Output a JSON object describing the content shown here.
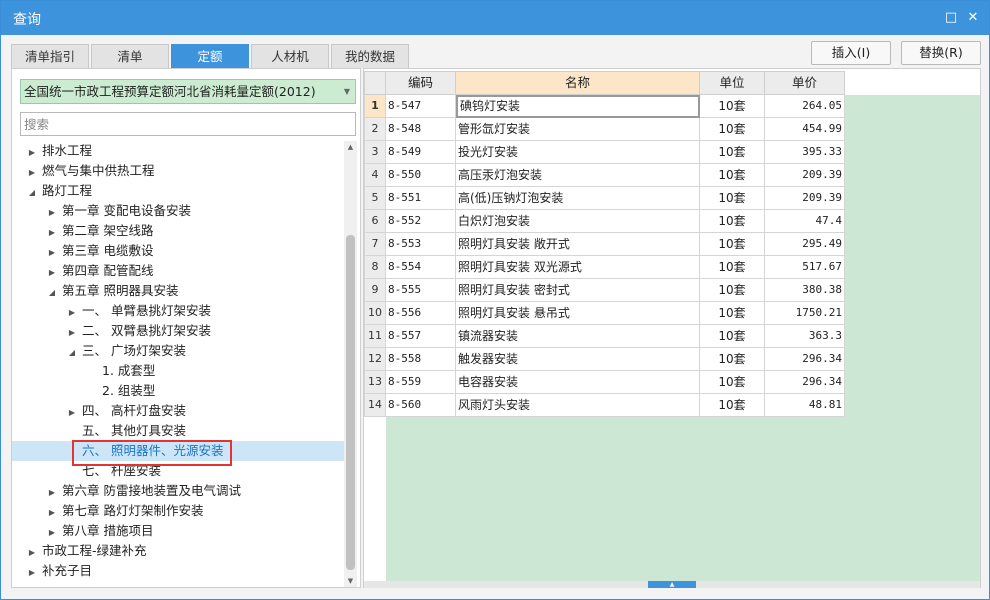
{
  "window": {
    "title": "查询",
    "maximize_glyph": "□",
    "close_glyph": "✕"
  },
  "tabs": [
    {
      "label": "清单指引",
      "active": false
    },
    {
      "label": "清单",
      "active": false
    },
    {
      "label": "定额",
      "active": true
    },
    {
      "label": "人材机",
      "active": false
    },
    {
      "label": "我的数据",
      "active": false
    }
  ],
  "toolbar": {
    "insert_label": "插入(I)",
    "replace_label": "替换(R)"
  },
  "left_panel": {
    "quota_book": "全国统一市政工程预算定额河北省消耗量定额(2012)",
    "search_placeholder": "搜索",
    "tree": [
      {
        "label": "排水工程",
        "level": 0,
        "state": "collapsed"
      },
      {
        "label": "燃气与集中供热工程",
        "level": 0,
        "state": "collapsed"
      },
      {
        "label": "路灯工程",
        "level": 0,
        "state": "expanded"
      },
      {
        "label": "第一章 变配电设备安装",
        "level": 1,
        "state": "collapsed"
      },
      {
        "label": "第二章 架空线路",
        "level": 1,
        "state": "collapsed"
      },
      {
        "label": "第三章 电缆敷设",
        "level": 1,
        "state": "collapsed"
      },
      {
        "label": "第四章 配管配线",
        "level": 1,
        "state": "collapsed"
      },
      {
        "label": "第五章 照明器具安装",
        "level": 1,
        "state": "expanded"
      },
      {
        "label": "一、 单臂悬挑灯架安装",
        "level": 2,
        "state": "collapsed"
      },
      {
        "label": "二、 双臂悬挑灯架安装",
        "level": 2,
        "state": "collapsed"
      },
      {
        "label": "三、 广场灯架安装",
        "level": 2,
        "state": "expanded"
      },
      {
        "label": "1. 成套型",
        "level": 3,
        "state": "leaf"
      },
      {
        "label": "2. 组装型",
        "level": 3,
        "state": "leaf"
      },
      {
        "label": "四、 高杆灯盘安装",
        "level": 2,
        "state": "collapsed"
      },
      {
        "label": "五、 其他灯具安装",
        "level": 2,
        "state": "leaf"
      },
      {
        "label": "六、 照明器件、光源安装",
        "level": 2,
        "state": "leaf",
        "selected": true
      },
      {
        "label": "七、 杆座安装",
        "level": 2,
        "state": "leaf"
      },
      {
        "label": "第六章 防雷接地装置及电气调试",
        "level": 1,
        "state": "collapsed"
      },
      {
        "label": "第七章 路灯灯架制作安装",
        "level": 1,
        "state": "collapsed"
      },
      {
        "label": "第八章 措施项目",
        "level": 1,
        "state": "collapsed"
      },
      {
        "label": "市政工程-绿建补充",
        "level": 0,
        "state": "collapsed"
      },
      {
        "label": "补充子目",
        "level": 0,
        "state": "collapsed"
      }
    ]
  },
  "table": {
    "columns": [
      "编码",
      "名称",
      "单位",
      "单价"
    ],
    "rows": [
      {
        "no": "1",
        "code": "8-547",
        "name": "碘钨灯安装",
        "unit": "10套",
        "price": "264.05"
      },
      {
        "no": "2",
        "code": "8-548",
        "name": "管形氙灯安装",
        "unit": "10套",
        "price": "454.99"
      },
      {
        "no": "3",
        "code": "8-549",
        "name": "投光灯安装",
        "unit": "10套",
        "price": "395.33"
      },
      {
        "no": "4",
        "code": "8-550",
        "name": "高压汞灯泡安装",
        "unit": "10套",
        "price": "209.39"
      },
      {
        "no": "5",
        "code": "8-551",
        "name": "高(低)压钠灯泡安装",
        "unit": "10套",
        "price": "209.39"
      },
      {
        "no": "6",
        "code": "8-552",
        "name": "白炽灯泡安装",
        "unit": "10套",
        "price": "47.4"
      },
      {
        "no": "7",
        "code": "8-553",
        "name": "照明灯具安装 敞开式",
        "unit": "10套",
        "price": "295.49"
      },
      {
        "no": "8",
        "code": "8-554",
        "name": "照明灯具安装 双光源式",
        "unit": "10套",
        "price": "517.67"
      },
      {
        "no": "9",
        "code": "8-555",
        "name": "照明灯具安装 密封式",
        "unit": "10套",
        "price": "380.38"
      },
      {
        "no": "10",
        "code": "8-556",
        "name": "照明灯具安装 悬吊式",
        "unit": "10套",
        "price": "1750.21"
      },
      {
        "no": "11",
        "code": "8-557",
        "name": "镇流器安装",
        "unit": "10套",
        "price": "363.3"
      },
      {
        "no": "12",
        "code": "8-558",
        "name": "触发器安装",
        "unit": "10套",
        "price": "296.34"
      },
      {
        "no": "13",
        "code": "8-559",
        "name": "电容器安装",
        "unit": "10套",
        "price": "296.34"
      },
      {
        "no": "14",
        "code": "8-560",
        "name": "风雨灯头安装",
        "unit": "10套",
        "price": "48.81"
      }
    ]
  },
  "colors": {
    "accent": "#3e93dd",
    "selection_outline": "#e23434",
    "empty_grid": "#cce7d3"
  }
}
